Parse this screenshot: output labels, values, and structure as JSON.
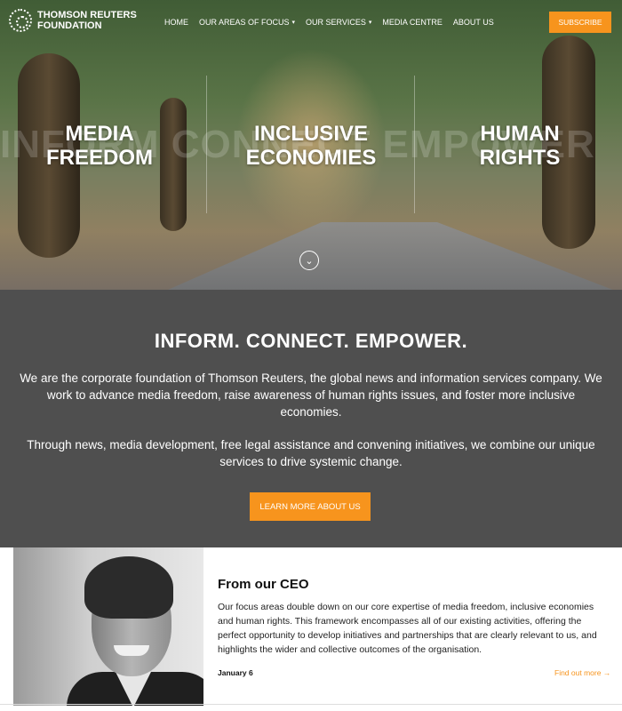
{
  "logo": {
    "line1": "THOMSON REUTERS",
    "line2": "FOUNDATION"
  },
  "nav": {
    "items": [
      {
        "label": "HOME",
        "has_dropdown": false
      },
      {
        "label": "OUR AREAS OF FOCUS",
        "has_dropdown": true
      },
      {
        "label": "OUR SERVICES",
        "has_dropdown": true
      },
      {
        "label": "MEDIA CENTRE",
        "has_dropdown": false
      },
      {
        "label": "ABOUT US",
        "has_dropdown": false
      }
    ],
    "subscribe_label": "SUBSCRIBE"
  },
  "hero": {
    "themes": [
      {
        "line1": "MEDIA",
        "line2": "FREEDOM"
      },
      {
        "line1": "INCLUSIVE",
        "line2": "ECONOMIES"
      },
      {
        "line1": "HUMAN",
        "line2": "RIGHTS"
      }
    ],
    "background_words": "INFORM   CONNECT   EMPOWER"
  },
  "mission": {
    "heading": "INFORM. CONNECT. EMPOWER.",
    "paragraph1": "We are the corporate foundation of Thomson Reuters, the global news and information services company. We work to advance media freedom, raise awareness of human rights issues, and foster more inclusive economies.",
    "paragraph2": "Through news, media development, free legal assistance and convening initiatives, we combine our unique services to drive systemic change.",
    "button_label": "LEARN MORE ABOUT US"
  },
  "ceo": {
    "title": "From our CEO",
    "body": "Our focus areas double down on our core expertise of media freedom, inclusive economies and human rights. This framework encompasses all of our existing activities, offering the perfect opportunity to develop initiatives and partnerships that are clearly relevant to us, and highlights the wider and collective outcomes of the organisation.",
    "date": "January 6",
    "link_label": "Find out more"
  },
  "colors": {
    "accent": "#f7941d",
    "mission_bg": "#4f4f4f"
  }
}
